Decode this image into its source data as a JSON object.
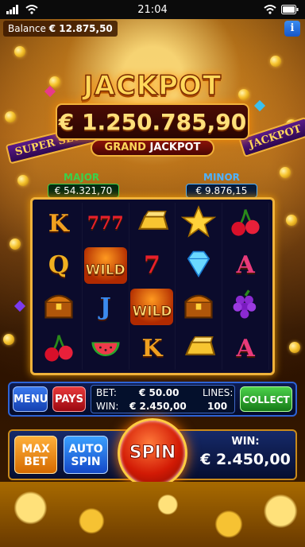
{
  "status_bar": {
    "time": "21:04"
  },
  "balance": {
    "label": "Balance",
    "value": "€ 12.875,50"
  },
  "info_button": {
    "label": "i"
  },
  "jackpot": {
    "title": "JACKPOT",
    "amount": "€ 1.250.785,90",
    "grand_label_1": "GRAND",
    "grand_label_2": "JACKPOT"
  },
  "signs": {
    "left": "SUPER SLOT",
    "right": "JACKPOT"
  },
  "major": {
    "label": "MAJOR",
    "value": "€ 54.321,70",
    "color": "#3bd14a"
  },
  "minor": {
    "label": "MINOR",
    "value": "€ 9.876,15",
    "color": "#4fb3ff"
  },
  "reels": [
    [
      "K",
      "777",
      "gold-bar",
      "star",
      "cherries"
    ],
    [
      "Q",
      "WILD",
      "7",
      "diamond",
      "A"
    ],
    [
      "chest",
      "J",
      "WILD",
      "chest",
      "grapes"
    ],
    [
      "cherries",
      "watermelon",
      "K",
      "gold-bar",
      "A"
    ]
  ],
  "controls": {
    "menu": "MENU",
    "pays": "PAYS",
    "bet_label": "BET:",
    "bet_value": "€ 50.00",
    "win_label": "WIN:",
    "win_value": "€ 2.450,00",
    "lines_label": "LINES:",
    "lines_value": "100",
    "collect": "COLLECT"
  },
  "bottom": {
    "max_bet_1": "MAX",
    "max_bet_2": "BET",
    "auto_spin_1": "AUTO",
    "auto_spin_2": "SPIN",
    "spin": "SPIN",
    "win_label": "WIN:",
    "win_value": "€ 2.450,00"
  }
}
